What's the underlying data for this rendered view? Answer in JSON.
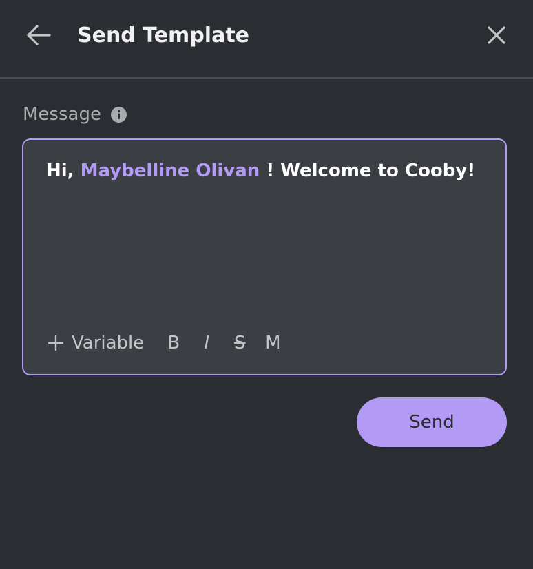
{
  "header": {
    "title": "Send Template",
    "back_icon": "arrow-left-icon",
    "close_icon": "close-icon"
  },
  "message_field": {
    "label": "Message",
    "info_icon": "info-icon",
    "content": {
      "prefix": "Hi, ",
      "variable": "Maybelline Olivan",
      "suffix": " ! Welcome to Cooby!"
    }
  },
  "toolbar": {
    "add_variable_label": "Variable",
    "bold_label": "B",
    "italic_label": "I",
    "strikethrough_label": "S",
    "monospace_label": "M"
  },
  "actions": {
    "send_label": "Send"
  },
  "colors": {
    "background": "#2a2d31",
    "editor_background": "#3b3e43",
    "accent": "#b39bf5",
    "divider": "#4a4d52"
  }
}
